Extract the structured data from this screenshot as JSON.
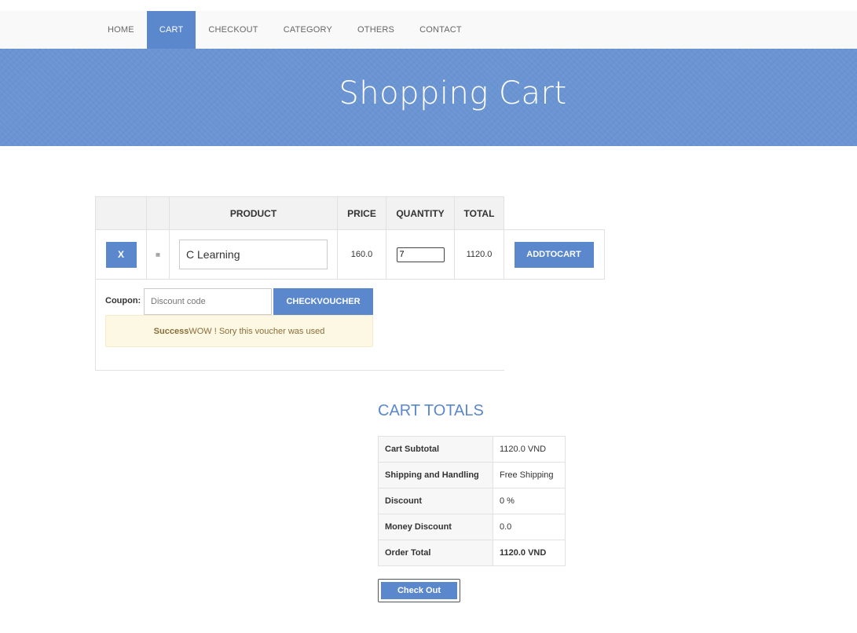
{
  "nav": {
    "items": [
      {
        "label": "HOME",
        "active": false
      },
      {
        "label": "CART",
        "active": true
      },
      {
        "label": "CHECKOUT",
        "active": false
      },
      {
        "label": "CATEGORY",
        "active": false
      },
      {
        "label": "OTHERS",
        "active": false
      },
      {
        "label": "CONTACT",
        "active": false
      }
    ]
  },
  "banner": {
    "title": "Shopping Cart"
  },
  "cart": {
    "headers": {
      "product": "PRODUCT",
      "price": "PRICE",
      "quantity": "QUANTITY",
      "total": "TOTAL"
    },
    "row": {
      "remove_label": "X",
      "thumbnail_icon": "image-placeholder-icon",
      "product_name": "C Learning",
      "price": "160.0",
      "quantity": "7",
      "total": "1120.0",
      "add_label": "ADDTOCART"
    }
  },
  "coupon": {
    "label": "Coupon:",
    "placeholder": "Discount code",
    "button_label": "CHECKVOUCHER",
    "alert_strong": "Success",
    "alert_text": "WOW ! Sory this voucher was used"
  },
  "totals": {
    "title": "CART TOTALS",
    "rows": [
      {
        "label": "Cart Subtotal",
        "value": "1120.0 VND"
      },
      {
        "label": "Shipping and Handling",
        "value": "Free Shipping"
      },
      {
        "label": "Discount",
        "value": "0 %"
      },
      {
        "label": "Money Discount",
        "value": "0.0"
      },
      {
        "label": "Order Total",
        "value": "1120.0 VND"
      }
    ],
    "checkout_label": "Check Out"
  },
  "colors": {
    "accent": "#5b87cd",
    "banner": "#6a94d2",
    "alert_bg": "#fcf8e3"
  }
}
